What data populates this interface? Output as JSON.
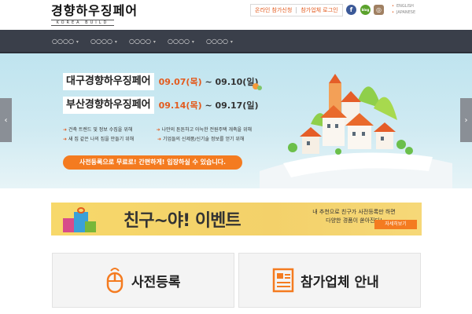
{
  "header": {
    "logo_text": "경향하우징페어",
    "logo_sub": "KOREA BUILD",
    "top_buttons": [
      "온라인 참가신청",
      "참가업체 로그인"
    ],
    "sns_icons": [
      "facebook-icon",
      "blog-icon",
      "instagram-icon"
    ],
    "sns_glyphs": {
      "facebook": "f",
      "blog": "blog",
      "instagram": "◎"
    },
    "languages": [
      "ENGLISH",
      "JAPANESE"
    ]
  },
  "nav": {
    "items": [
      "○○○○",
      "○○○○",
      "○○○○",
      "○○○○",
      "○○○○"
    ]
  },
  "banner": {
    "events": [
      {
        "title": "대구경향하우징페어",
        "date_start": "09.07(목)",
        "tilde": "~",
        "date_end": "09.10(일)"
      },
      {
        "title": "부산경향하우징페어",
        "date_start": "09.14(목)",
        "tilde": "~",
        "date_end": "09.17(일)"
      }
    ],
    "bullets": [
      "건축 트렌드 및 정보 수집을 위해",
      "나만의 튼튼하고 아늑한 전원주택 개축을 위해",
      "새 집 같은 나의 집을 만들기 위해",
      "기업들의 신제품/신기술 정보를 얻기 위해"
    ],
    "cta": "사전등록으로 무료로! 간편하게! 입장하실 수 있습니다.",
    "arrow_left": "‹",
    "arrow_right": "›"
  },
  "event_strip": {
    "title": "친구~야! 이벤트",
    "desc_line1": "내 추천으로 친구가 사전등록만 하면",
    "desc_line2": "다양한 경품이 쏟아진다!",
    "button": "자세히보기"
  },
  "cards": [
    {
      "label": "사전등록",
      "icon": "mouse-click-icon"
    },
    {
      "label": "참가업체 안내",
      "icon": "document-list-icon"
    }
  ],
  "colors": {
    "accent": "#f47b20",
    "nav_bg": "#3a3f4a",
    "banner_sky": "#c9e7f0"
  }
}
